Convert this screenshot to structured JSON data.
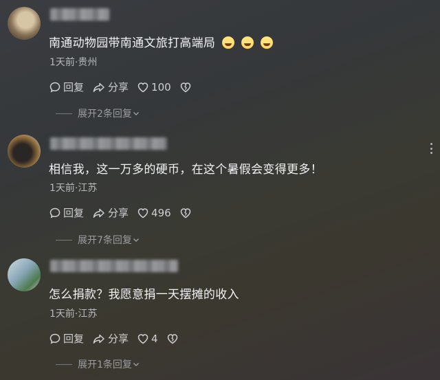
{
  "comments": [
    {
      "text": "南通动物园带南通文旅打高端局",
      "emoji_count": 3,
      "meta": "1天前·贵州",
      "reply_label": "回复",
      "share_label": "分享",
      "like_count": "100",
      "expand_label": "展开2条回复"
    },
    {
      "text": "相信我，这一万多的硬币，在这个暑假会变得更多！",
      "meta": "1天前·江苏",
      "reply_label": "回复",
      "share_label": "分享",
      "like_count": "496",
      "expand_label": "展开7条回复"
    },
    {
      "text": "怎么捐款？我愿意捐一天摆摊的收入",
      "meta": "1天前·江苏",
      "reply_label": "回复",
      "share_label": "分享",
      "like_count": "4",
      "expand_label": "展开1条回复"
    }
  ],
  "icons": {
    "reply": "comment-bubble-icon",
    "share": "share-arrow-icon",
    "like": "heart-icon",
    "dislike": "broken-heart-icon",
    "expand": "chevron-down-icon",
    "more": "more-vertical-icon",
    "emoji": "laughing-tears-emoji"
  }
}
